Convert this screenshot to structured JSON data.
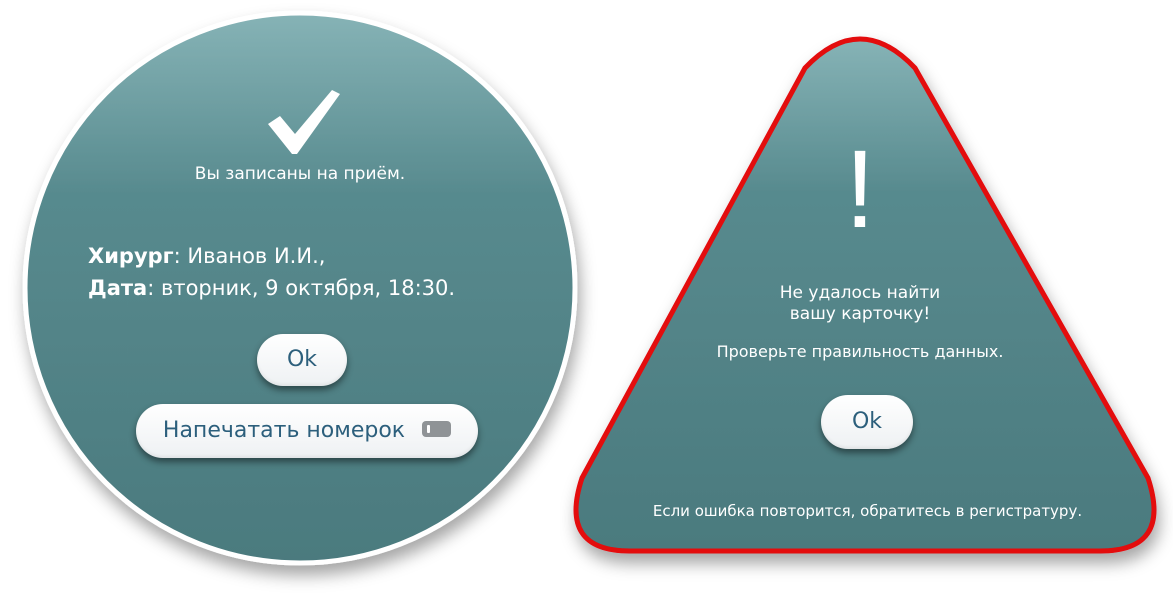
{
  "success_dialog": {
    "message": "Вы записаны на приём.",
    "surgeon_label": "Хирург",
    "surgeon_value": ": Иванов И.И.,",
    "date_label": "Дата",
    "date_value": ": вторник, 9 октября, 18:30.",
    "ok_label": "Ok",
    "print_label": "Напечатать номерок"
  },
  "error_dialog": {
    "exclamation": "!",
    "title_line1": "Не удалось найти",
    "title_line2": "вашу карточку!",
    "hint": "Проверьте правильность данных.",
    "ok_label": "Ok",
    "footer": "Если ошибка повторится, обратитесь в регистратуру."
  },
  "colors": {
    "panel_teal": "#4e7e82",
    "panel_teal_light": "#7aa9ad",
    "error_border": "#e3070c",
    "button_text": "#2c5f7c",
    "white": "#ffffff"
  },
  "icons": {
    "success": "checkmark-icon",
    "print": "ticket-icon"
  }
}
